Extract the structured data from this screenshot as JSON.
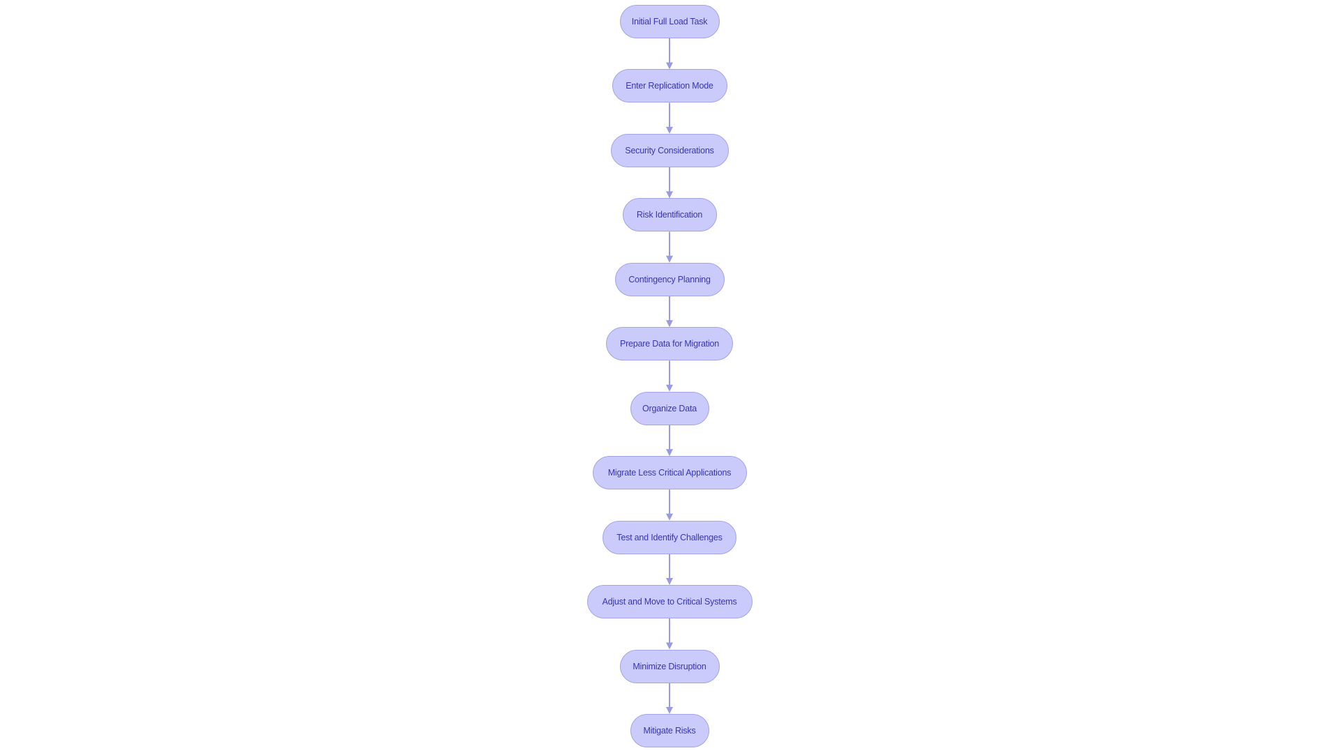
{
  "diagram": {
    "type": "flowchart",
    "direction": "top-to-bottom",
    "colors": {
      "node_fill": "#cbcbfb",
      "node_border": "#a3a3e6",
      "node_text": "#3636b0",
      "edge": "#9a9ae2",
      "background": "#ffffff"
    },
    "nodes": [
      {
        "id": "n1",
        "label": "Initial Full Load Task"
      },
      {
        "id": "n2",
        "label": "Enter Replication Mode"
      },
      {
        "id": "n3",
        "label": "Security Considerations"
      },
      {
        "id": "n4",
        "label": "Risk Identification"
      },
      {
        "id": "n5",
        "label": "Contingency Planning"
      },
      {
        "id": "n6",
        "label": "Prepare Data for Migration"
      },
      {
        "id": "n7",
        "label": "Organize Data"
      },
      {
        "id": "n8",
        "label": "Migrate Less Critical Applications"
      },
      {
        "id": "n9",
        "label": "Test and Identify Challenges"
      },
      {
        "id": "n10",
        "label": "Adjust and Move to Critical Systems"
      },
      {
        "id": "n11",
        "label": "Minimize Disruption"
      },
      {
        "id": "n12",
        "label": "Mitigate Risks"
      }
    ],
    "edges": [
      {
        "from": "n1",
        "to": "n2"
      },
      {
        "from": "n2",
        "to": "n3"
      },
      {
        "from": "n3",
        "to": "n4"
      },
      {
        "from": "n4",
        "to": "n5"
      },
      {
        "from": "n5",
        "to": "n6"
      },
      {
        "from": "n6",
        "to": "n7"
      },
      {
        "from": "n7",
        "to": "n8"
      },
      {
        "from": "n8",
        "to": "n9"
      },
      {
        "from": "n9",
        "to": "n10"
      },
      {
        "from": "n10",
        "to": "n11"
      },
      {
        "from": "n11",
        "to": "n12"
      }
    ]
  }
}
